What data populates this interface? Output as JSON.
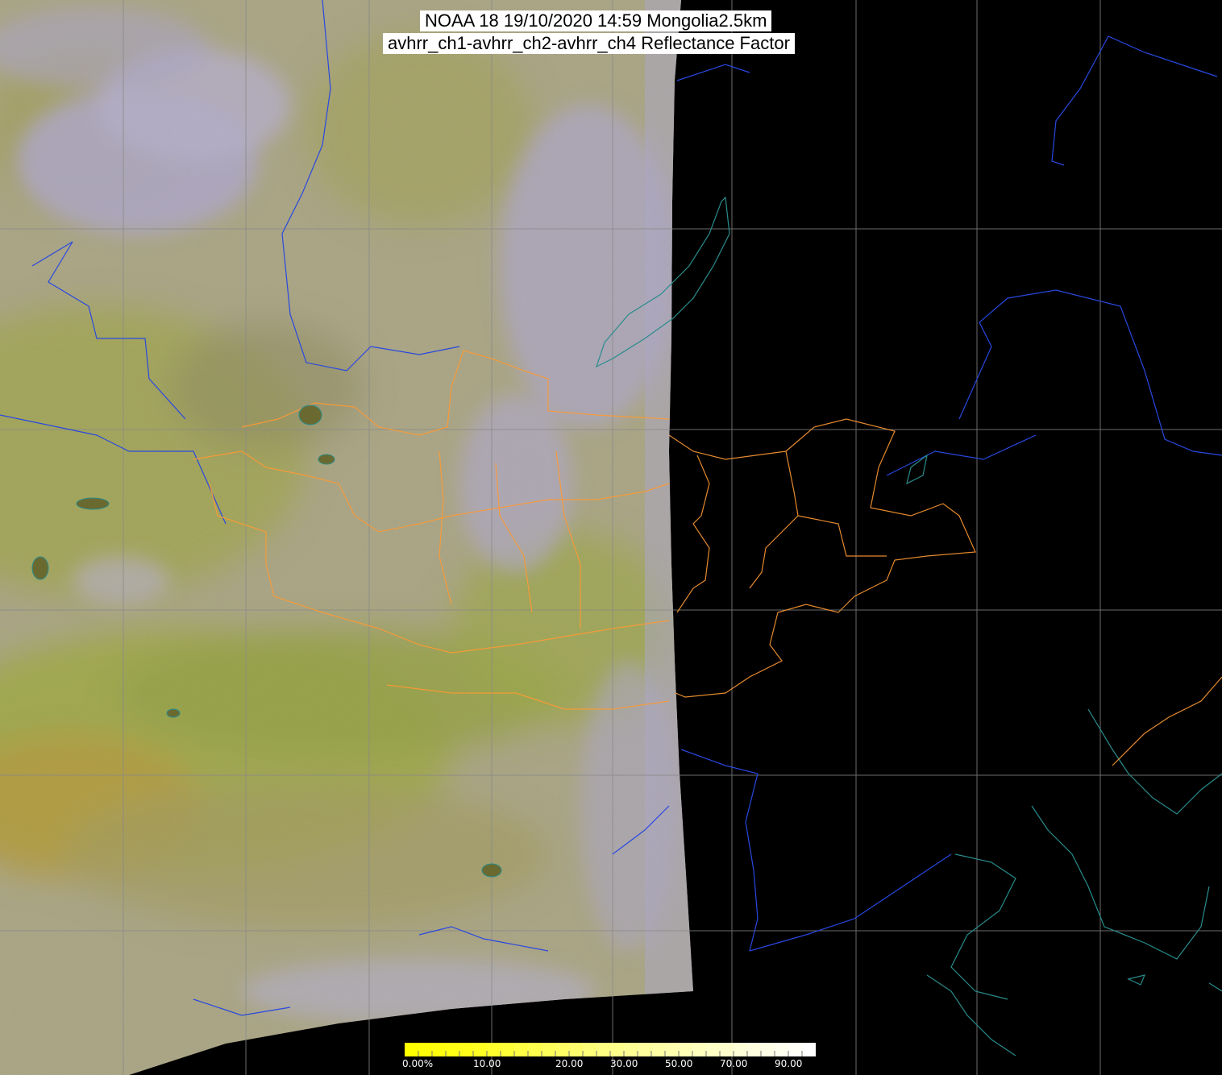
{
  "title": {
    "line1": "NOAA 18 19/10/2020 14:59 Mongolia2.5km",
    "line2": "avhrr_ch1-avhrr_ch2-avhrr_ch4 Reflectance Factor"
  },
  "colorbar": {
    "labels": [
      "0.00%",
      "10.00",
      "20.00",
      "30.00",
      "50.00",
      "70.00",
      "90.00"
    ],
    "colors": [
      "#ffff00",
      "#ffff20",
      "#ffff55",
      "#ffff88",
      "#ffffb0",
      "#ffffd8",
      "#ffffff"
    ]
  },
  "colors": {
    "background": "#000000",
    "land_green": "#a8b040",
    "land_olive": "#8c8a3a",
    "cloud_lavender": "#b8b0f0",
    "haze_grey": "#b4ae98",
    "grid": "#888888",
    "rivers_coasts": "#2244dd",
    "admin_borders": "#ff9933",
    "lakes_coast_cyan": "#2a8a8a"
  }
}
